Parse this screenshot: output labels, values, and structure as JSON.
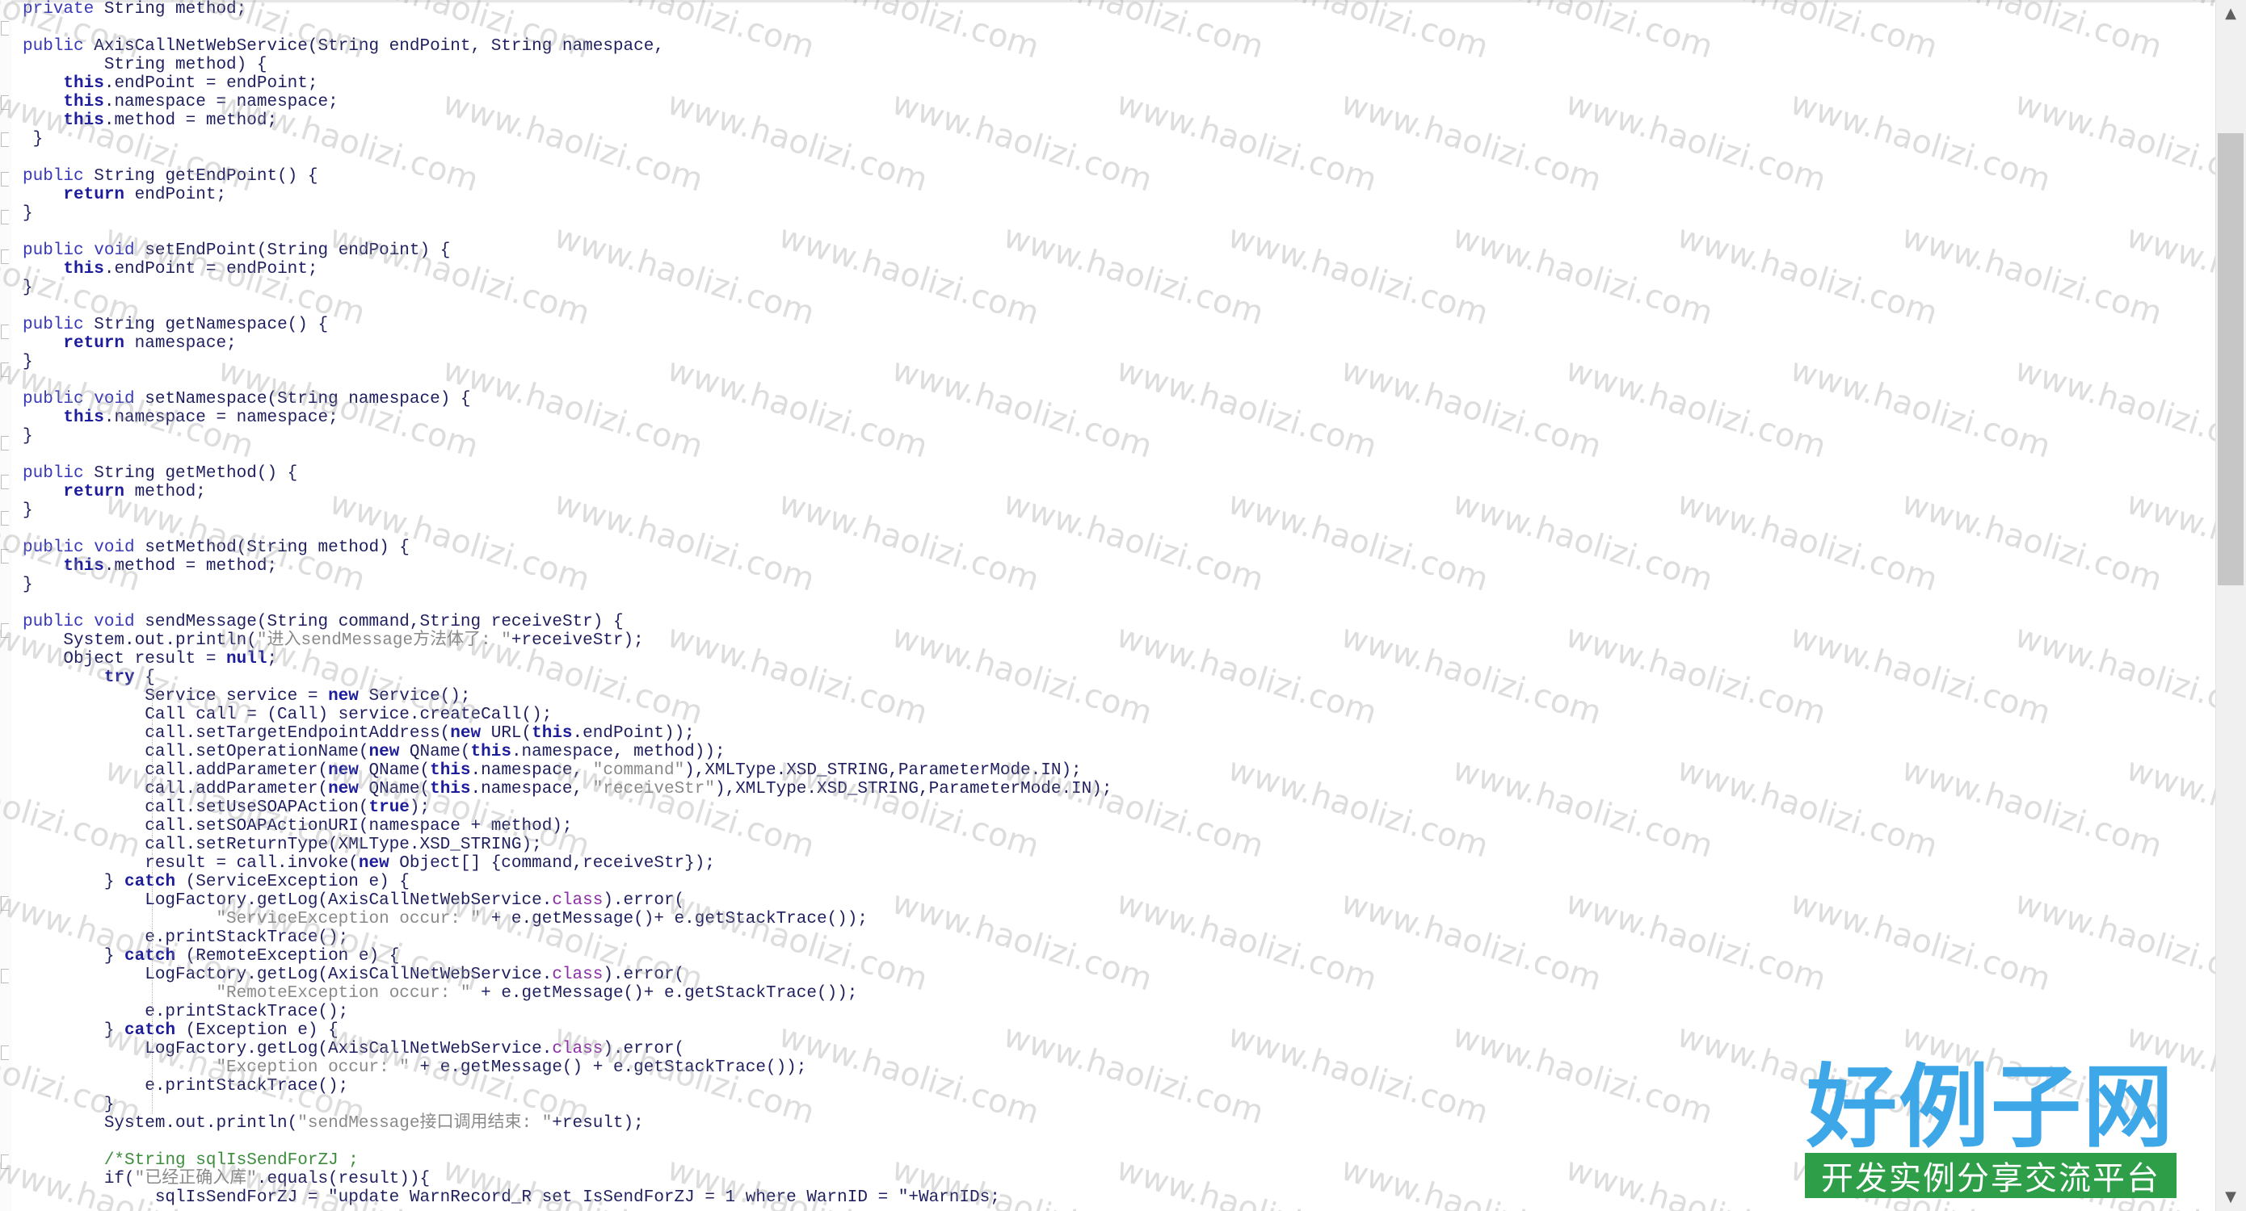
{
  "editor": {
    "code_lines": [
      [
        [
          "kw",
          "private"
        ],
        [
          "t",
          " String method;"
        ]
      ],
      [
        [
          "t",
          ""
        ]
      ],
      [
        [
          "kw",
          "public"
        ],
        [
          "t",
          " AxisCallNetWebService(String endPoint, String namespace,"
        ]
      ],
      [
        [
          "t",
          "        String method) {"
        ]
      ],
      [
        [
          "t",
          "    "
        ],
        [
          "kwb",
          "this"
        ],
        [
          "t",
          ".endPoint = endPoint;"
        ]
      ],
      [
        [
          "t",
          "    "
        ],
        [
          "kwb",
          "this"
        ],
        [
          "t",
          ".namespace = namespace;"
        ]
      ],
      [
        [
          "t",
          "    "
        ],
        [
          "kwb",
          "this"
        ],
        [
          "t",
          ".method = method;"
        ]
      ],
      [
        [
          "t",
          " }"
        ]
      ],
      [
        [
          "t",
          ""
        ]
      ],
      [
        [
          "kw",
          "public"
        ],
        [
          "t",
          " String getEndPoint() {"
        ]
      ],
      [
        [
          "t",
          "    "
        ],
        [
          "kwb",
          "return"
        ],
        [
          "t",
          " endPoint;"
        ]
      ],
      [
        [
          "t",
          "}"
        ]
      ],
      [
        [
          "t",
          ""
        ]
      ],
      [
        [
          "kw",
          "public"
        ],
        [
          "t",
          " "
        ],
        [
          "kw",
          "void"
        ],
        [
          "t",
          " setEndPoint(String endPoint) {"
        ]
      ],
      [
        [
          "t",
          "    "
        ],
        [
          "kwb",
          "this"
        ],
        [
          "t",
          ".endPoint = endPoint;"
        ]
      ],
      [
        [
          "t",
          "}"
        ]
      ],
      [
        [
          "t",
          ""
        ]
      ],
      [
        [
          "kw",
          "public"
        ],
        [
          "t",
          " String getNamespace() {"
        ]
      ],
      [
        [
          "t",
          "    "
        ],
        [
          "kwb",
          "return"
        ],
        [
          "t",
          " namespace;"
        ]
      ],
      [
        [
          "t",
          "}"
        ]
      ],
      [
        [
          "t",
          ""
        ]
      ],
      [
        [
          "kw",
          "public"
        ],
        [
          "t",
          " "
        ],
        [
          "kw",
          "void"
        ],
        [
          "t",
          " setNamespace(String namespace) {"
        ]
      ],
      [
        [
          "t",
          "    "
        ],
        [
          "kwb",
          "this"
        ],
        [
          "t",
          ".namespace = namespace;"
        ]
      ],
      [
        [
          "t",
          "}"
        ]
      ],
      [
        [
          "t",
          ""
        ]
      ],
      [
        [
          "kw",
          "public"
        ],
        [
          "t",
          " String getMethod() {"
        ]
      ],
      [
        [
          "t",
          "    "
        ],
        [
          "kwb",
          "return"
        ],
        [
          "t",
          " method;"
        ]
      ],
      [
        [
          "t",
          "}"
        ]
      ],
      [
        [
          "t",
          ""
        ]
      ],
      [
        [
          "kw",
          "public"
        ],
        [
          "t",
          " "
        ],
        [
          "kw",
          "void"
        ],
        [
          "t",
          " setMethod(String method) {"
        ]
      ],
      [
        [
          "t",
          "    "
        ],
        [
          "kwb",
          "this"
        ],
        [
          "t",
          ".method = method;"
        ]
      ],
      [
        [
          "t",
          "}"
        ]
      ],
      [
        [
          "t",
          ""
        ]
      ],
      [
        [
          "kw",
          "public"
        ],
        [
          "t",
          " "
        ],
        [
          "kw",
          "void"
        ],
        [
          "t",
          " sendMessage(String command,String receiveStr) {"
        ]
      ],
      [
        [
          "t",
          "    System.out.println("
        ],
        [
          "str",
          "\"进入sendMessage方法体了: \""
        ],
        [
          "t",
          "+receiveStr);"
        ]
      ],
      [
        [
          "t",
          "    Object result = "
        ],
        [
          "kwb",
          "null"
        ],
        [
          "t",
          ";"
        ]
      ],
      [
        [
          "t",
          "        "
        ],
        [
          "kwb",
          "try"
        ],
        [
          "t",
          " {"
        ]
      ],
      [
        [
          "t",
          "            Service service = "
        ],
        [
          "kwb",
          "new"
        ],
        [
          "t",
          " Service();"
        ]
      ],
      [
        [
          "t",
          "            Call call = (Call) service.createCall();"
        ]
      ],
      [
        [
          "t",
          "            call.setTargetEndpointAddress("
        ],
        [
          "kwb",
          "new"
        ],
        [
          "t",
          " URL("
        ],
        [
          "kwb",
          "this"
        ],
        [
          "t",
          ".endPoint));"
        ]
      ],
      [
        [
          "t",
          "            call.setOperationName("
        ],
        [
          "kwb",
          "new"
        ],
        [
          "t",
          " QName("
        ],
        [
          "kwb",
          "this"
        ],
        [
          "t",
          ".namespace, method));"
        ]
      ],
      [
        [
          "t",
          "            call.addParameter("
        ],
        [
          "kwb",
          "new"
        ],
        [
          "t",
          " QName("
        ],
        [
          "kwb",
          "this"
        ],
        [
          "t",
          ".namespace, "
        ],
        [
          "str",
          "\"command\""
        ],
        [
          "t",
          "),XMLType.XSD_STRING,ParameterMode.IN);"
        ]
      ],
      [
        [
          "t",
          "            call.addParameter("
        ],
        [
          "kwb",
          "new"
        ],
        [
          "t",
          " QName("
        ],
        [
          "kwb",
          "this"
        ],
        [
          "t",
          ".namespace, "
        ],
        [
          "str",
          "\"receiveStr\""
        ],
        [
          "t",
          "),XMLType.XSD_STRING,ParameterMode.IN);"
        ]
      ],
      [
        [
          "t",
          "            call.setUseSOAPAction("
        ],
        [
          "kwb",
          "true"
        ],
        [
          "t",
          ");"
        ]
      ],
      [
        [
          "t",
          "            call.setSOAPActionURI(namespace + method);"
        ]
      ],
      [
        [
          "t",
          "            call.setReturnType(XMLType.XSD_STRING);"
        ]
      ],
      [
        [
          "t",
          "            result = call.invoke("
        ],
        [
          "kwb",
          "new"
        ],
        [
          "t",
          " Object[] {command,receiveStr});"
        ]
      ],
      [
        [
          "t",
          "        } "
        ],
        [
          "kwb",
          "catch"
        ],
        [
          "t",
          " (ServiceException e) {"
        ]
      ],
      [
        [
          "t",
          "            LogFactory.getLog(AxisCallNetWebService."
        ],
        [
          "cls",
          "class"
        ],
        [
          "t",
          ").error("
        ]
      ],
      [
        [
          "t",
          "                   "
        ],
        [
          "str",
          "\"ServiceException occur: \""
        ],
        [
          "t",
          " + e.getMessage()+ e.getStackTrace());"
        ]
      ],
      [
        [
          "t",
          "            e.printStackTrace();"
        ]
      ],
      [
        [
          "t",
          "        } "
        ],
        [
          "kwb",
          "catch"
        ],
        [
          "t",
          " (RemoteException e) {"
        ]
      ],
      [
        [
          "t",
          "            LogFactory.getLog(AxisCallNetWebService."
        ],
        [
          "cls",
          "class"
        ],
        [
          "t",
          ").error("
        ]
      ],
      [
        [
          "t",
          "                   "
        ],
        [
          "str",
          "\"RemoteException occur: \""
        ],
        [
          "t",
          " + e.getMessage()+ e.getStackTrace());"
        ]
      ],
      [
        [
          "t",
          "            e.printStackTrace();"
        ]
      ],
      [
        [
          "t",
          "        } "
        ],
        [
          "kwb",
          "catch"
        ],
        [
          "t",
          " (Exception e) {"
        ]
      ],
      [
        [
          "t",
          "            LogFactory.getLog(AxisCallNetWebService."
        ],
        [
          "cls",
          "class"
        ],
        [
          "t",
          ").error("
        ]
      ],
      [
        [
          "t",
          "                   "
        ],
        [
          "str",
          "\"Exception occur: \""
        ],
        [
          "t",
          " + e.getMessage() + e.getStackTrace());"
        ]
      ],
      [
        [
          "t",
          "            e.printStackTrace();"
        ]
      ],
      [
        [
          "t",
          "        }"
        ]
      ],
      [
        [
          "t",
          "        System.out.println("
        ],
        [
          "str",
          "\"sendMessage接口调用结束: \""
        ],
        [
          "t",
          "+result);"
        ]
      ],
      [
        [
          "t",
          ""
        ]
      ],
      [
        [
          "t",
          "        "
        ],
        [
          "cm",
          "/*String sqlIsSendForZJ ;"
        ]
      ],
      [
        [
          "t",
          "        if("
        ],
        [
          "str",
          "\"已经正确入库\""
        ],
        [
          "t",
          ".equals(result)){"
        ]
      ],
      [
        [
          "t",
          "             sqlIsSendForZJ = \"update WarnRecord_R set IsSendForZJ = 1 where WarnID = \"+WarnIDs;"
        ]
      ]
    ]
  },
  "watermark": {
    "text": "www.haolizi.com"
  },
  "logo": {
    "title": "好例子网",
    "tagline": "开发实例分享交流平台",
    "title_color": "#3ea7e8",
    "tagline_bg": "#2f9e48"
  },
  "scrollbar": {
    "up_icon": "▲",
    "down_icon": "▼"
  }
}
